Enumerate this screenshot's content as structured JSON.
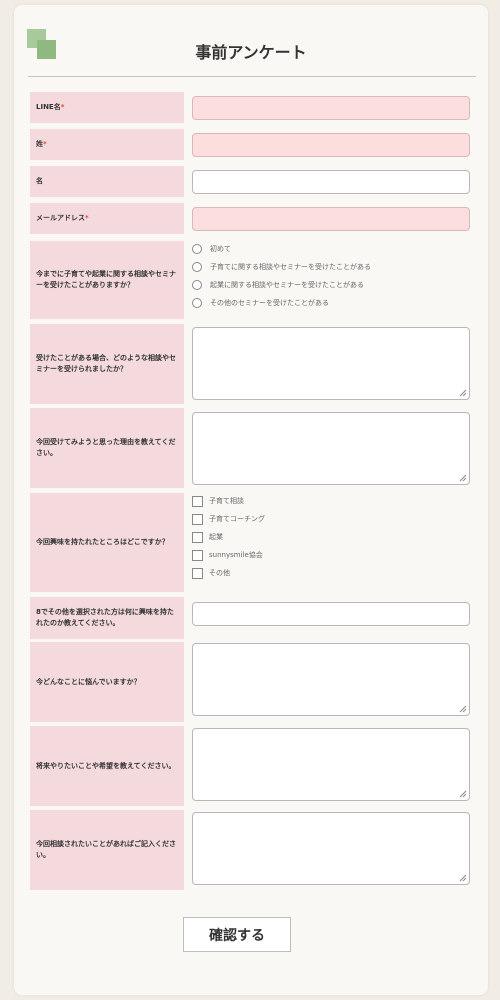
{
  "form": {
    "title": "事前アンケート",
    "required_mark": "*",
    "fields": {
      "line_name": {
        "label": "LINE名"
      },
      "sei": {
        "label": "姓"
      },
      "mei": {
        "label": "名"
      },
      "email": {
        "label": "メールアドレス"
      },
      "experience": {
        "label": "今までに子育てや起業に関する相談やセミナーを受けたことがありますか？",
        "options": [
          "初めて",
          "子育てに関する相談やセミナーを受けたことがある",
          "起業に関する相談やセミナーを受けたことがある",
          "その他のセミナーを受けたことがある"
        ]
      },
      "which_seminar": {
        "label": "受けたことがある場合、どのような相談やセミナーを受けられましたか？"
      },
      "reason": {
        "label": "今回受けてみようと思った理由を教えてください。"
      },
      "interest": {
        "label": "今回興味を持たれたところはどこですか？",
        "options": [
          "子育て相談",
          "子育てコーチング",
          "起業",
          "sunnysmile協会",
          "その他"
        ]
      },
      "other_interest": {
        "label": "8でその他を選択された方は何に興味を持たれたのか教えてください。"
      },
      "worries": {
        "label": "今どんなことに悩んでいますか？"
      },
      "future": {
        "label": "将来やりたいことや希望を教えてください。"
      },
      "consult": {
        "label": "今回相談されたいことがあればご記入ください。"
      }
    },
    "submit_label": "確認する"
  },
  "colors": {
    "label_bg": "#f4dadd",
    "required_input_bg": "#fcdede",
    "required_mark": "#e0473c",
    "page_bg": "#f2ede4",
    "card_bg": "#faf8f4",
    "logo_green": "#a8c99a"
  }
}
